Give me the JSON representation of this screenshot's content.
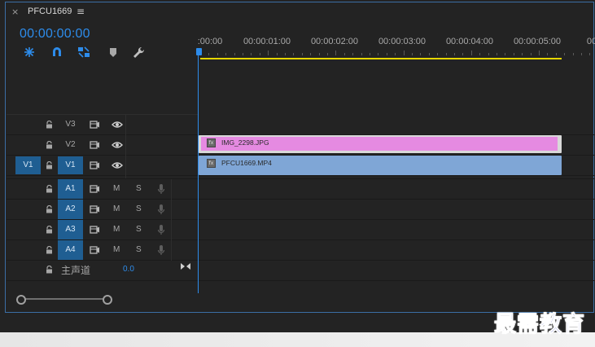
{
  "tab": {
    "close": "×",
    "name": "PFCU1669",
    "menu": "≡"
  },
  "timecode": "00:00:00:00",
  "ruler": [
    ":00:00",
    "00:00:01:00",
    "00:00:02:00",
    "00:00:03:00",
    "00:00:04:00",
    "00:00:05:00",
    "00"
  ],
  "video_tracks": [
    {
      "name": "V3",
      "source": ""
    },
    {
      "name": "V2",
      "source": ""
    },
    {
      "name": "V1",
      "source": "V1"
    }
  ],
  "audio_tracks": [
    {
      "name": "A1",
      "mute": "M",
      "solo": "S"
    },
    {
      "name": "A2",
      "mute": "M",
      "solo": "S"
    },
    {
      "name": "A3",
      "mute": "M",
      "solo": "S"
    },
    {
      "name": "A4",
      "mute": "M",
      "solo": "S"
    }
  ],
  "master": {
    "label": "主声道",
    "value": "0.0"
  },
  "clips": {
    "image": "IMG_2298.JPG",
    "video": "PFCU1669.MP4",
    "fx": "fx"
  },
  "watermark": "最需教育",
  "colors": {
    "accent": "#2d8ceb",
    "image_clip": "#e58ae1",
    "video_clip": "#7fa6d6",
    "work_area": "#e6d600"
  }
}
